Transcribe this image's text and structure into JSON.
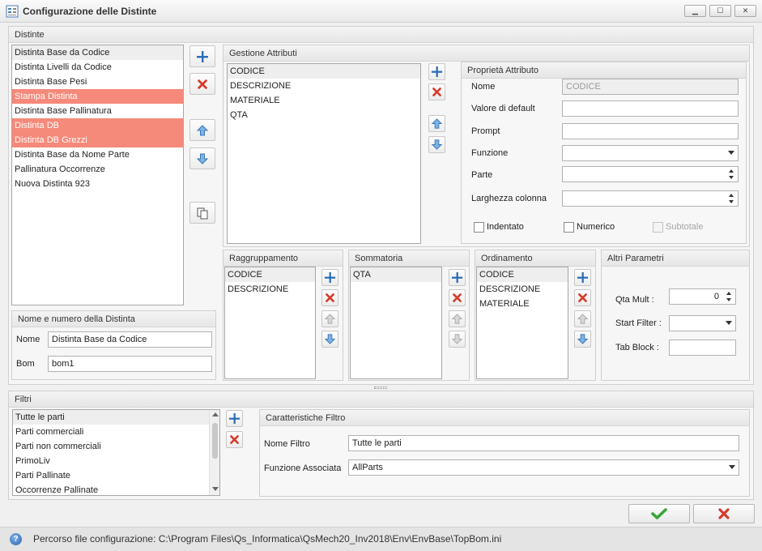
{
  "window": {
    "title": "Configurazione delle Distinte",
    "controls": {
      "minimize": "▁",
      "maximize": "☐",
      "close": "✕"
    }
  },
  "distinte": {
    "header": "Distinte",
    "items": [
      "Distinta Base da Codice",
      "Distinta Livelli da Codice",
      "Distinta Base Pesi",
      "Stampa Distinta",
      "Distinta Base Pallinatura",
      "Distinta DB",
      "Distinta DB Grezzi",
      "Distinta Base da Nome Parte",
      "Pallinatura Occorrenze",
      "Nuova Distinta 923"
    ]
  },
  "nome_numero": {
    "header": "Nome e numero della Distinta",
    "nome_label": "Nome",
    "nome_value": "Distinta Base da Codice",
    "bom_label": "Bom",
    "bom_value": "bom1"
  },
  "gestione_attributi": {
    "header": "Gestione Attributi",
    "items": [
      "CODICE",
      "DESCRIZIONE",
      "MATERIALE",
      "QTA"
    ]
  },
  "proprieta": {
    "header": "Proprietà Attributo",
    "nome_label": "Nome",
    "nome_value": "CODICE",
    "default_label": "Valore di default",
    "prompt_label": "Prompt",
    "funzione_label": "Funzione",
    "parte_label": "Parte",
    "larghezza_label": "Larghezza colonna",
    "indentato_label": "Indentato",
    "numerico_label": "Numerico",
    "subtotale_label": "Subtotale"
  },
  "raggruppamento": {
    "header": "Raggruppamento",
    "items": [
      "CODICE",
      "DESCRIZIONE"
    ]
  },
  "sommatoria": {
    "header": "Sommatoria",
    "items": [
      "QTA"
    ]
  },
  "ordinamento": {
    "header": "Ordinamento",
    "items": [
      "CODICE",
      "DESCRIZIONE",
      "MATERIALE"
    ]
  },
  "altri": {
    "header": "Altri Parametri",
    "qta_label": "Qta Mult :",
    "qta_value": "0",
    "start_label": "Start Filter :",
    "tab_label": "Tab Block :"
  },
  "filtri": {
    "header": "Filtri",
    "items": [
      "Tutte le parti",
      "Parti commerciali",
      "Parti non commerciali",
      "PrimoLiv",
      "Parti Pallinate",
      "Occorrenze Pallinate"
    ]
  },
  "caratteristiche": {
    "header": "Caratteristiche Filtro",
    "nome_label": "Nome Filtro",
    "nome_value": "Tutte le parti",
    "funzione_label": "Funzione Associata",
    "funzione_value": "AllParts"
  },
  "status": {
    "text": "Percorso file configurazione: C:\\Program Files\\Qs_Informatica\\QsMech20_Inv2018\\Env\\EnvBase\\TopBom.ini",
    "icon": "help-icon"
  },
  "colors": {
    "highlight": "#f5897a",
    "add_blue": "#2b6cb8",
    "delete_red": "#d83a2a",
    "ok_green": "#3aa53a"
  }
}
